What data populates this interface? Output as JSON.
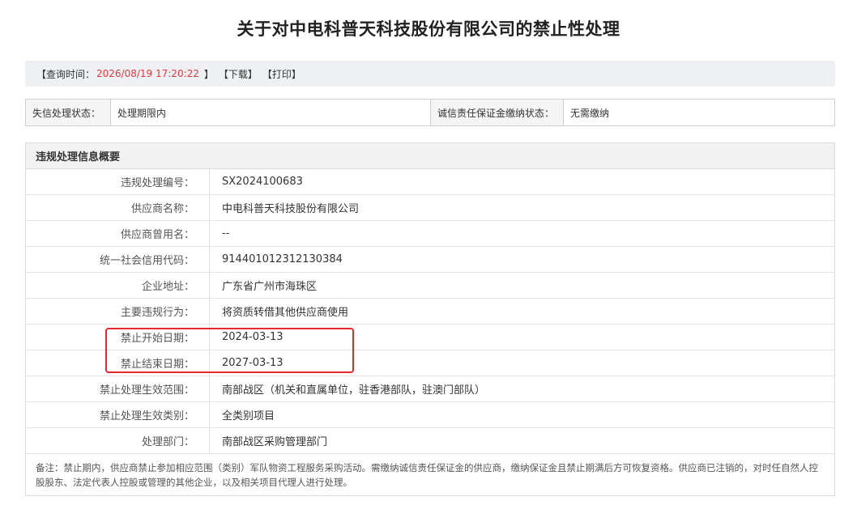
{
  "title": "关于对中电科普天科技股份有限公司的禁止性处理",
  "query_bar": {
    "time_label": "【查询时间：",
    "time_value": "2026/08/19 17:20:22",
    "time_close": "】",
    "download": "【下载】",
    "print": "【打印】"
  },
  "status": {
    "credit_label": "失信处理状态：",
    "credit_value": "处理期限内",
    "deposit_label": "诚信责任保证金缴纳状态：",
    "deposit_value": "无需缴纳"
  },
  "info": {
    "header": "违规处理信息概要",
    "rows": [
      {
        "key": "违规处理编号：",
        "value": "SX2024100683"
      },
      {
        "key": "供应商名称：",
        "value": "中电科普天科技股份有限公司"
      },
      {
        "key": "供应商曾用名：",
        "value": "--"
      },
      {
        "key": "统一社会信用代码：",
        "value": "914401012312130384"
      },
      {
        "key": "企业地址：",
        "value": "广东省广州市海珠区"
      },
      {
        "key": "主要违规行为：",
        "value": "将资质转借其他供应商使用"
      },
      {
        "key": "禁止开始日期：",
        "value": "2024-03-13"
      },
      {
        "key": "禁止结束日期：",
        "value": "2027-03-13"
      },
      {
        "key": "禁止处理生效范围：",
        "value": "南部战区（机关和直属单位，驻香港部队，驻澳门部队）"
      },
      {
        "key": "禁止处理生效类别：",
        "value": "全类别项目"
      },
      {
        "key": "处理部门：",
        "value": "南部战区采购管理部门"
      }
    ],
    "note": "备注：禁止期内，供应商禁止参加相应范围（类别）军队物资工程服务采购活动。需缴纳诚信责任保证金的供应商，缴纳保证金且禁止期满后方可恢复资格。供应商已注销的，对时任自然人控股股东、法定代表人控股或管理的其他企业，以及相关项目代理人进行处理。"
  },
  "colors": {
    "accent_red": "#e4393c",
    "highlight_border": "#e8262b"
  }
}
